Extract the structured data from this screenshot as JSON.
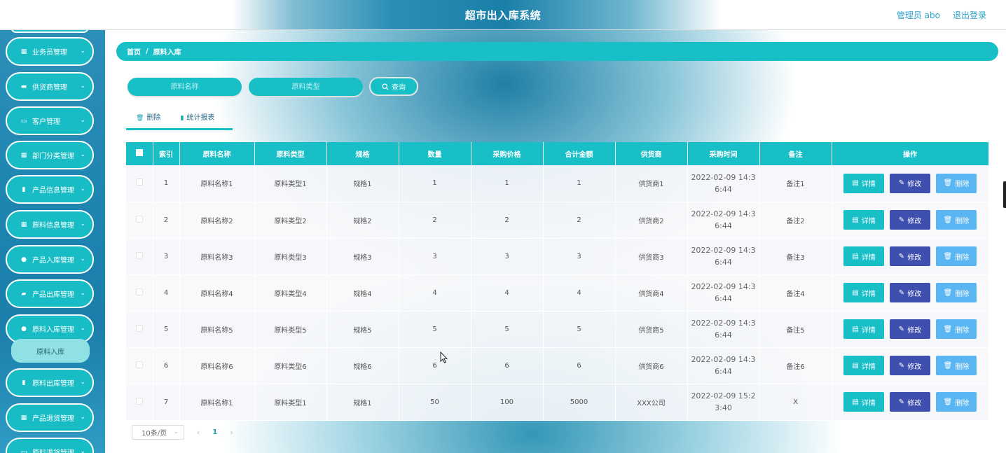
{
  "app": {
    "title": "超市出入库系统"
  },
  "header": {
    "user": "管理员 abo",
    "logout": "退出登录"
  },
  "sidebar": {
    "items": [
      {
        "label": "业务员管理",
        "icon": "grid-icon"
      },
      {
        "label": "供货商管理",
        "icon": "briefcase-icon"
      },
      {
        "label": "客户管理",
        "icon": "monitor-icon"
      },
      {
        "label": "部门分类管理",
        "icon": "grid-icon"
      },
      {
        "label": "产品信息管理",
        "icon": "clipboard-icon"
      },
      {
        "label": "原料信息管理",
        "icon": "grid-icon"
      },
      {
        "label": "产品入库管理",
        "icon": "user-icon"
      },
      {
        "label": "产品出库管理",
        "icon": "ticket-icon"
      },
      {
        "label": "原料入库管理",
        "icon": "user-icon"
      },
      {
        "label": "原料出库管理",
        "icon": "clipboard-icon"
      },
      {
        "label": "产品退货管理",
        "icon": "table-icon"
      },
      {
        "label": "原料退货管理",
        "icon": "monitor-icon"
      }
    ],
    "active_sub": "原料入库"
  },
  "breadcrumb": {
    "home": "首页",
    "sep": "/",
    "current": "原料入库"
  },
  "search": {
    "name_placeholder": "原料名称",
    "type_placeholder": "原料类型",
    "button": "查询"
  },
  "tabs": {
    "delete": "删除",
    "report": "统计报表"
  },
  "table": {
    "headers": [
      "索引",
      "原料名称",
      "原料类型",
      "规格",
      "数量",
      "采购价格",
      "合计金额",
      "供货商",
      "采购时间",
      "备注",
      "操作"
    ],
    "rows": [
      {
        "idx": "1",
        "name": "原料名称1",
        "type": "原料类型1",
        "spec": "规格1",
        "qty": "1",
        "price": "1",
        "total": "1",
        "supplier": "供货商1",
        "time1": "2022-02-09 14:3",
        "time2": "6:44",
        "note": "备注1"
      },
      {
        "idx": "2",
        "name": "原料名称2",
        "type": "原料类型2",
        "spec": "规格2",
        "qty": "2",
        "price": "2",
        "total": "2",
        "supplier": "供货商2",
        "time1": "2022-02-09 14:3",
        "time2": "6:44",
        "note": "备注2"
      },
      {
        "idx": "3",
        "name": "原料名称3",
        "type": "原料类型3",
        "spec": "规格3",
        "qty": "3",
        "price": "3",
        "total": "3",
        "supplier": "供货商3",
        "time1": "2022-02-09 14:3",
        "time2": "6:44",
        "note": "备注3"
      },
      {
        "idx": "4",
        "name": "原料名称4",
        "type": "原料类型4",
        "spec": "规格4",
        "qty": "4",
        "price": "4",
        "total": "4",
        "supplier": "供货商4",
        "time1": "2022-02-09 14:3",
        "time2": "6:44",
        "note": "备注4"
      },
      {
        "idx": "5",
        "name": "原料名称5",
        "type": "原料类型5",
        "spec": "规格5",
        "qty": "5",
        "price": "5",
        "total": "5",
        "supplier": "供货商5",
        "time1": "2022-02-09 14:3",
        "time2": "6:44",
        "note": "备注5"
      },
      {
        "idx": "6",
        "name": "原料名称6",
        "type": "原料类型6",
        "spec": "规格6",
        "qty": "6",
        "price": "6",
        "total": "6",
        "supplier": "供货商6",
        "time1": "2022-02-09 14:3",
        "time2": "6:44",
        "note": "备注6"
      },
      {
        "idx": "7",
        "name": "原料名称1",
        "type": "原料类型1",
        "spec": "规格1",
        "qty": "50",
        "price": "100",
        "total": "5000",
        "supplier": "XXX公司",
        "time1": "2022-02-09 15:2",
        "time2": "3:40",
        "note": "X"
      }
    ],
    "actions": {
      "detail": "详情",
      "edit": "修改",
      "delete": "删除"
    }
  },
  "pagination": {
    "page_size": "10条/页",
    "current_page": "1"
  },
  "colors": {
    "accent": "#18bfc7",
    "edit": "#3f4fb0",
    "delete": "#5ab6f2"
  }
}
